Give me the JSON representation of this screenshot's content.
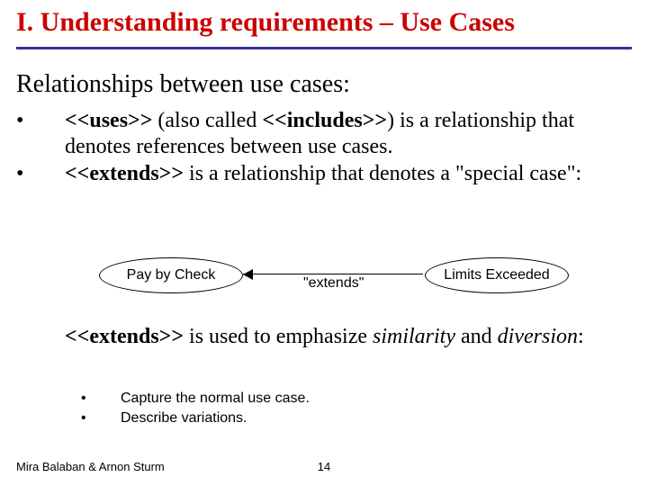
{
  "title": "I. Understanding requirements – Use Cases",
  "subheading": "Relationships between use cases:",
  "bullet_marker": "•",
  "b1": {
    "uses_tag": "<<uses>>",
    "uses_rest": "  (also called ",
    "includes_tag": "<<includes>>",
    "uses_tail": ") is a relationship that denotes references between use cases.",
    "extends_tag": "<<extends>>",
    "extends_rest": " is a relationship that denotes a \"special case\":"
  },
  "diagram": {
    "left": "Pay by  Check",
    "label": "\"extends\"",
    "right": "Limits  Exceeded"
  },
  "para2": {
    "lead_tag": "<<extends>>",
    "mid1": " is used to emphasize ",
    "em1": "similarity",
    "mid2": " and ",
    "em2": "diversion",
    "tail": ":"
  },
  "b2": {
    "i0": "Capture the normal use case.",
    "i1": "Describe variations."
  },
  "footer": {
    "authors": "Mira Balaban  &  Arnon Sturm",
    "page": "14"
  }
}
